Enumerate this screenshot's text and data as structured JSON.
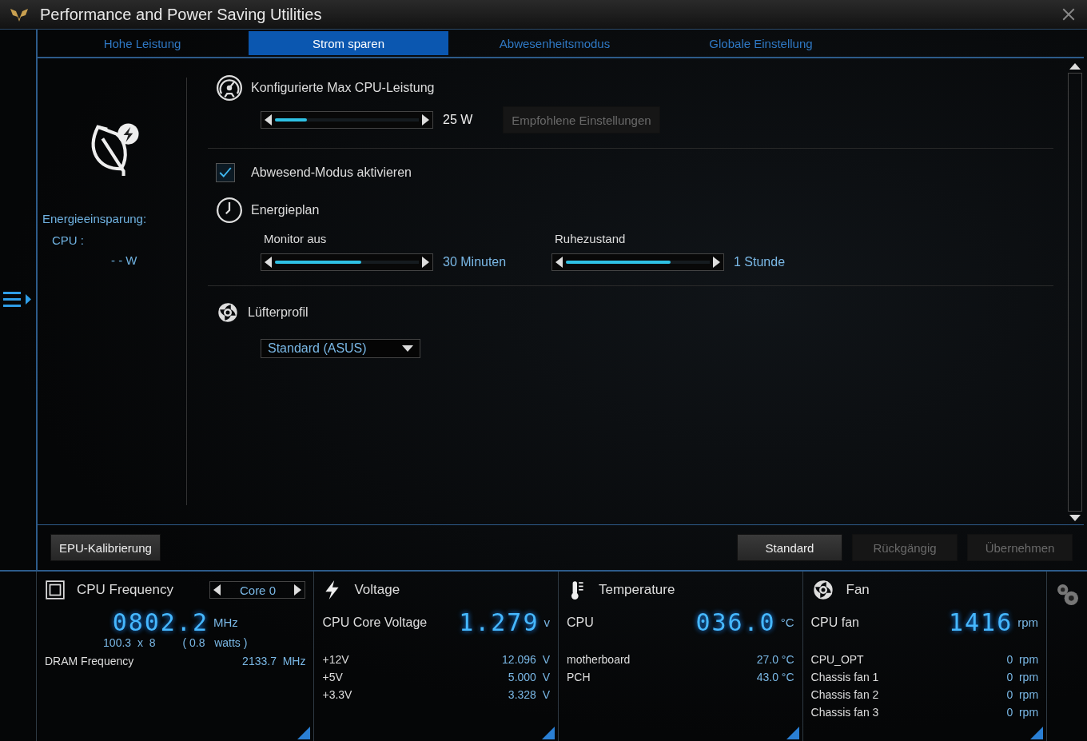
{
  "window": {
    "title": "Performance and Power Saving Utilities"
  },
  "tabs": [
    {
      "label": "Hohe Leistung",
      "selected": false
    },
    {
      "label": "Strom sparen",
      "selected": true
    },
    {
      "label": "Abwesenheitsmodus",
      "selected": false
    },
    {
      "label": "Globale Einstellung",
      "selected": false
    }
  ],
  "savings": {
    "title": "Energieeinsparung:",
    "cpu_label": "CPU :",
    "cpu_value": "- - W"
  },
  "max_cpu": {
    "title": "Konfigurierte Max CPU-Leistung",
    "level": 0.22,
    "reading": "25 W",
    "button": {
      "label": "Empfohlene Einstellungen",
      "disabled": true
    }
  },
  "away_mode": {
    "label": "Abwesend-Modus aktivieren",
    "checked": true
  },
  "power_plan": {
    "title": "Energieplan",
    "sliders": [
      {
        "label": "Monitor aus",
        "level": 0.6,
        "reading": "30 Minuten"
      },
      {
        "label": "Ruhezustand",
        "level": 0.73,
        "reading": "1 Stunde"
      }
    ]
  },
  "fan_profile": {
    "title": "Lüfterprofil",
    "value": "Standard (ASUS)"
  },
  "left_buttons": [
    {
      "label": "EPU-Kalibrierung",
      "disabled": false
    }
  ],
  "right_buttons": [
    {
      "label": "Standard",
      "disabled": false
    },
    {
      "label": "Rückgängig",
      "disabled": true
    },
    {
      "label": "Übernehmen",
      "disabled": true
    }
  ],
  "panels": [
    {
      "kind": "cpu",
      "title": "CPU Frequency",
      "core": "Core 0",
      "value": "0802.2",
      "unit": "MHz",
      "sub": [
        "100.3  x  8",
        "( 0.8   watts )"
      ],
      "rows": [
        {
          "label": "DRAM Frequency",
          "value": "2133.7  MHz"
        }
      ]
    },
    {
      "kind": "voltage",
      "title": "Voltage",
      "main_label": "CPU Core Voltage",
      "value": "1.279",
      "unit": "v",
      "rows": [
        {
          "label": "+12V",
          "value": "12.096  V"
        },
        {
          "label": "+5V",
          "value": "5.000  V"
        },
        {
          "label": "+3.3V",
          "value": "3.328  V"
        }
      ]
    },
    {
      "kind": "temperature",
      "title": "Temperature",
      "main_label": "CPU",
      "value": "036.0",
      "unit": "°C",
      "rows": [
        {
          "label": "motherboard",
          "value": "27.0 °C"
        },
        {
          "label": "PCH",
          "value": "43.0 °C"
        }
      ]
    },
    {
      "kind": "fan",
      "title": "Fan",
      "main_label": "CPU fan",
      "value": "1416",
      "unit": "rpm",
      "rows": [
        {
          "label": "CPU_OPT",
          "value": "0  rpm"
        },
        {
          "label": "Chassis fan 1",
          "value": "0  rpm"
        },
        {
          "label": "Chassis fan 2",
          "value": "0  rpm"
        },
        {
          "label": "Chassis fan 3",
          "value": "0  rpm"
        }
      ]
    }
  ]
}
